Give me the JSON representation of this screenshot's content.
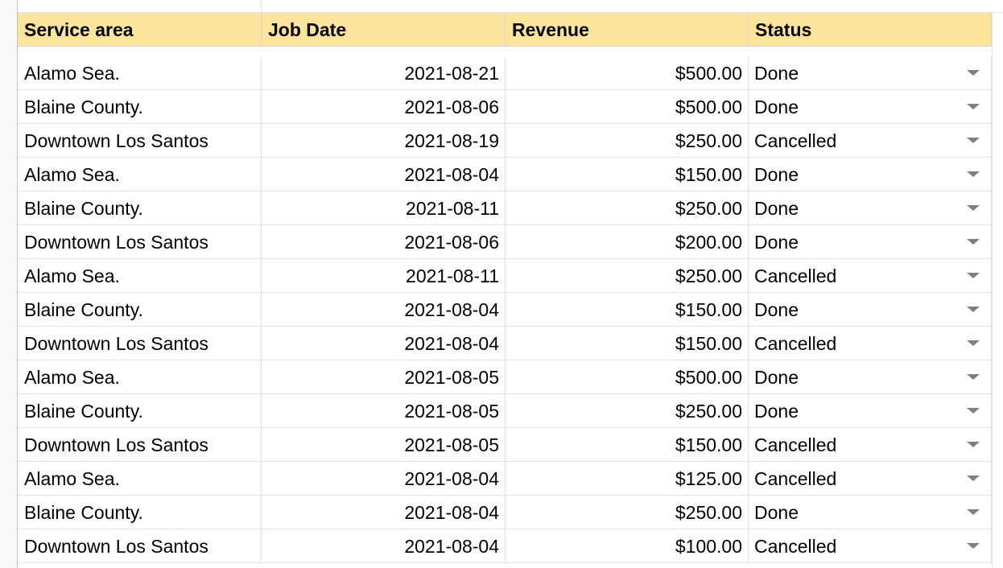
{
  "header": {
    "col_a": "Service area",
    "col_b": "Job Date",
    "col_c": "Revenue",
    "col_d": "Status"
  },
  "colors": {
    "header_bg": "#fde49b",
    "grid": "#e2e2e2",
    "caret": "#7f7f7f"
  },
  "rows": [
    {
      "area": "Alamo Sea.",
      "date": "2021-08-21",
      "revenue": "$500.00",
      "status": "Done"
    },
    {
      "area": "Blaine County.",
      "date": "2021-08-06",
      "revenue": "$500.00",
      "status": "Done"
    },
    {
      "area": "Downtown Los Santos",
      "date": "2021-08-19",
      "revenue": "$250.00",
      "status": "Cancelled"
    },
    {
      "area": "Alamo Sea.",
      "date": "2021-08-04",
      "revenue": "$150.00",
      "status": "Done"
    },
    {
      "area": "Blaine County.",
      "date": "2021-08-11",
      "revenue": "$250.00",
      "status": "Done"
    },
    {
      "area": "Downtown Los Santos",
      "date": "2021-08-06",
      "revenue": "$200.00",
      "status": "Done"
    },
    {
      "area": "Alamo Sea.",
      "date": "2021-08-11",
      "revenue": "$250.00",
      "status": "Cancelled"
    },
    {
      "area": "Blaine County.",
      "date": "2021-08-04",
      "revenue": "$150.00",
      "status": "Done"
    },
    {
      "area": "Downtown Los Santos",
      "date": "2021-08-04",
      "revenue": "$150.00",
      "status": "Cancelled"
    },
    {
      "area": "Alamo Sea.",
      "date": "2021-08-05",
      "revenue": "$500.00",
      "status": "Done"
    },
    {
      "area": "Blaine County.",
      "date": "2021-08-05",
      "revenue": "$250.00",
      "status": "Done"
    },
    {
      "area": "Downtown Los Santos",
      "date": "2021-08-05",
      "revenue": "$150.00",
      "status": "Cancelled"
    },
    {
      "area": "Alamo Sea.",
      "date": "2021-08-04",
      "revenue": "$125.00",
      "status": "Cancelled"
    },
    {
      "area": "Blaine County.",
      "date": "2021-08-04",
      "revenue": "$250.00",
      "status": "Done"
    },
    {
      "area": "Downtown Los Santos",
      "date": "2021-08-04",
      "revenue": "$100.00",
      "status": "Cancelled"
    }
  ]
}
